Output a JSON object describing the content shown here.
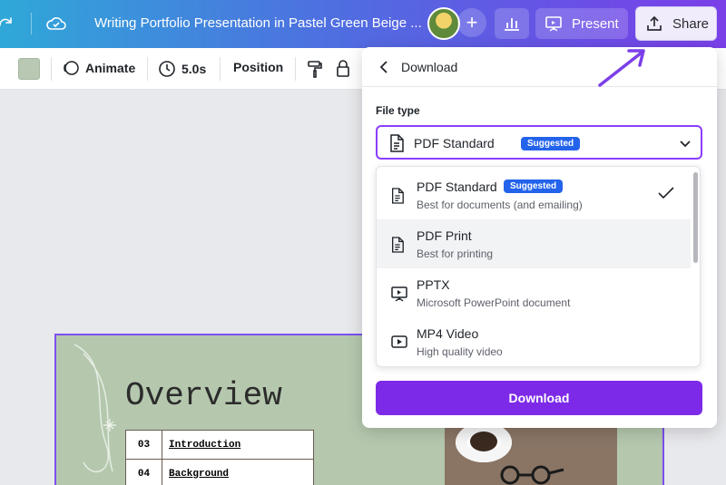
{
  "header": {
    "title": "Writing Portfolio Presentation in Pastel Green Beige ...",
    "present_label": "Present",
    "share_label": "Share"
  },
  "toolbar": {
    "animate_label": "Animate",
    "duration_label": "5.0s",
    "position_label": "Position",
    "swatch_color": "#b8c8b2"
  },
  "slide": {
    "heading": "Overview",
    "toc": [
      {
        "num": "03",
        "text": "Introduction"
      },
      {
        "num": "04",
        "text": "Background"
      }
    ]
  },
  "download": {
    "title": "Download",
    "file_type_label": "File type",
    "selected": "PDF Standard",
    "suggested_badge": "Suggested",
    "options": [
      {
        "name": "PDF Standard",
        "desc": "Best for documents (and emailing)",
        "icon": "document-icon",
        "suggested": true,
        "checked": true
      },
      {
        "name": "PDF Print",
        "desc": "Best for printing",
        "icon": "document-icon",
        "suggested": false,
        "checked": false
      },
      {
        "name": "PPTX",
        "desc": "Microsoft PowerPoint document",
        "icon": "presentation-icon",
        "suggested": false,
        "checked": false
      },
      {
        "name": "MP4 Video",
        "desc": "High quality video",
        "icon": "video-icon",
        "suggested": false,
        "checked": false
      }
    ],
    "button_label": "Download"
  },
  "colors": {
    "accent": "#8b3dff",
    "download_button": "#7d2ae8",
    "badge": "#2463eb",
    "annotation_arrow": "#7b3fe8"
  }
}
